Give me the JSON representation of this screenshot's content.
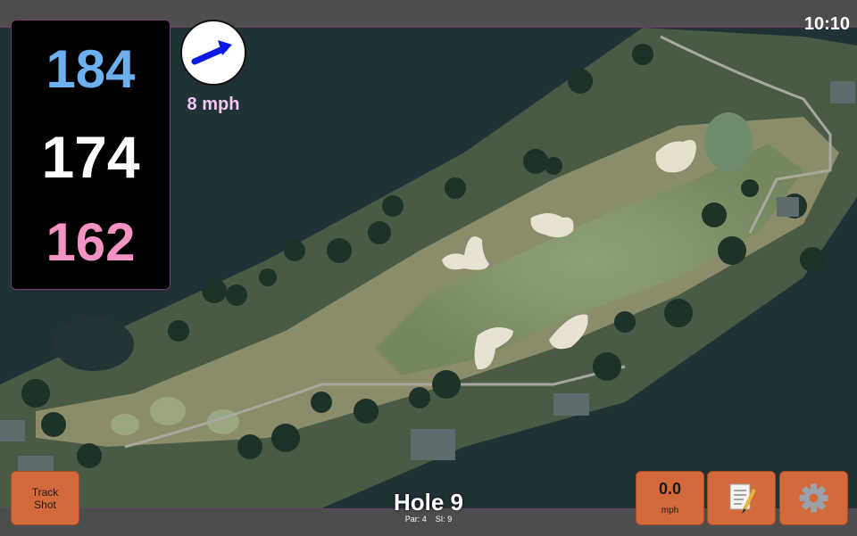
{
  "status": {
    "time": "10:10"
  },
  "distances": {
    "back": "184",
    "middle": "174",
    "front": "162"
  },
  "wind": {
    "speed": "8 mph",
    "direction_icon": "wind-arrow-icon"
  },
  "hole": {
    "title": "Hole 9",
    "par_label": "Par: 4",
    "si_label": "SI: 9"
  },
  "buttons": {
    "track_shot_line1": "Track",
    "track_shot_line2": "Shot",
    "speed_value": "0.0",
    "speed_unit": "mph",
    "notes_icon": "notepad-icon",
    "settings_icon": "gear-icon"
  },
  "colors": {
    "back_distance": "#6db0f0",
    "middle_distance": "#ffffff",
    "front_distance": "#f293c4",
    "button_orange": "#d46a3c",
    "wind_text": "#f2c6f0"
  }
}
